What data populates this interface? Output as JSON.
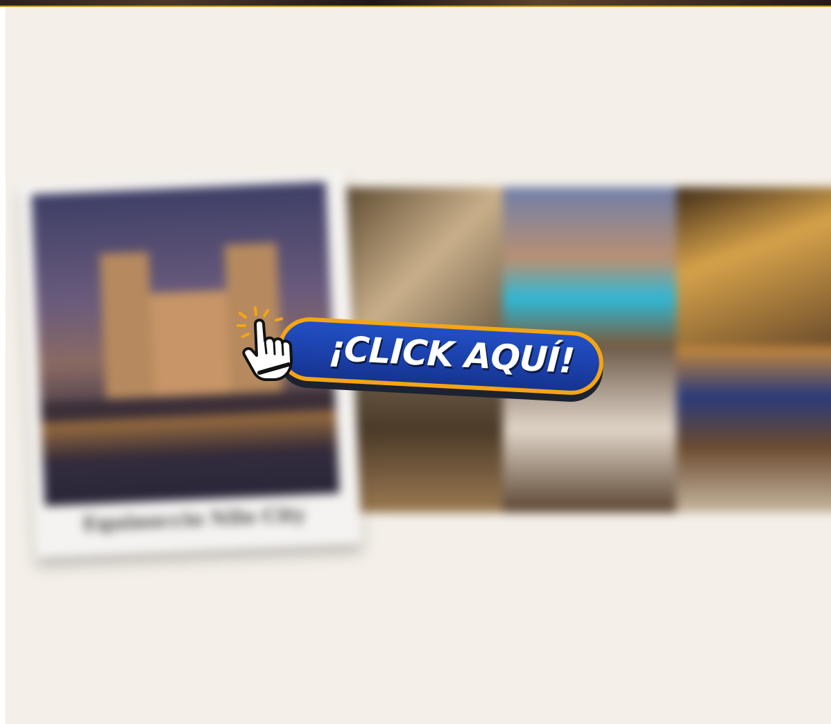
{
  "banner": {
    "cta_label": "¡CLICK AQUÍ!"
  },
  "polaroid": {
    "caption": "Equinoccio Nilo City"
  },
  "colors": {
    "background": "#f4f0e9",
    "cta_blue": "#1b3fa8",
    "cta_border": "#f5a513",
    "cta_text": "#ffffff"
  },
  "icons": {
    "cta_icon": "pointing-hand-click-icon"
  }
}
